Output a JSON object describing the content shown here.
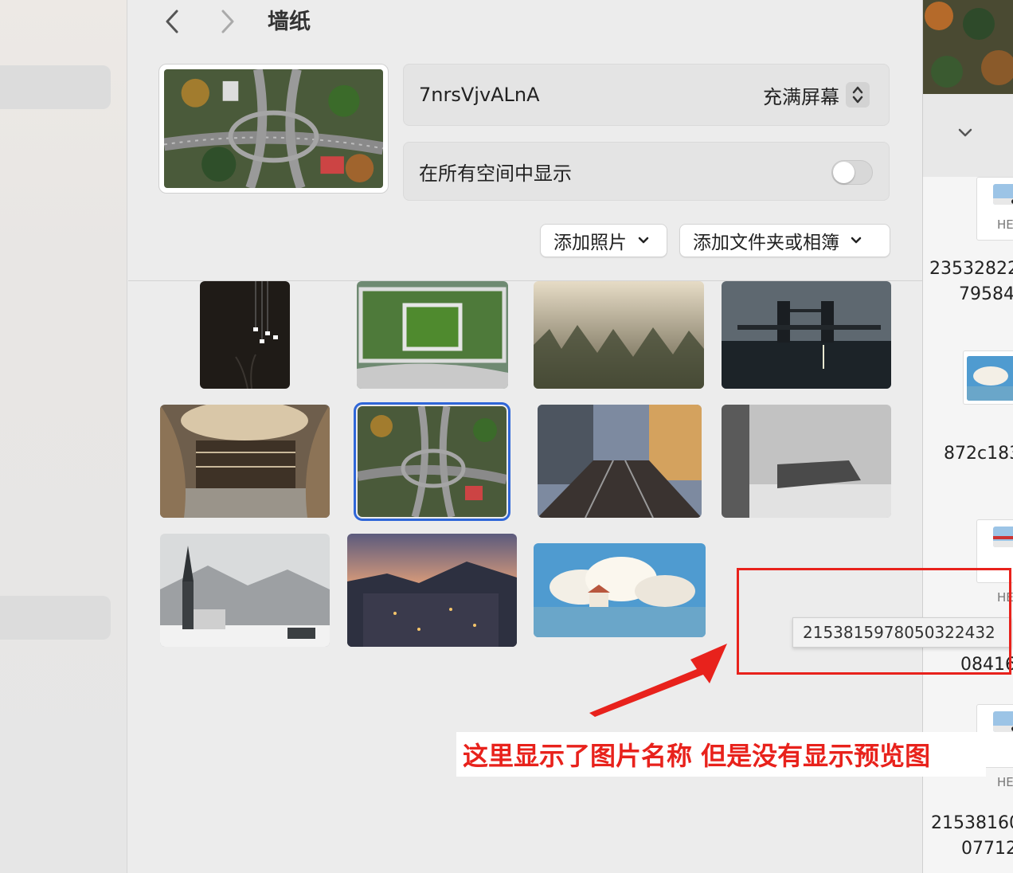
{
  "header": {
    "title": "墙纸"
  },
  "wallpaper": {
    "name": "7nrsVjvALnA",
    "fit_mode": "充满屏幕",
    "show_all_spaces_label": "在所有空间中显示",
    "show_all_spaces_on": false
  },
  "buttons": {
    "add_photo": "添加照片",
    "add_folder": "添加文件夹或相簿"
  },
  "gallery": [
    {
      "name": "pendant-lights"
    },
    {
      "name": "green-rooftop"
    },
    {
      "name": "foggy-forest"
    },
    {
      "name": "tower-bridge"
    },
    {
      "name": "atrium"
    },
    {
      "name": "highway-interchange",
      "selected": true
    },
    {
      "name": "railway-tracks"
    },
    {
      "name": "snow-train"
    },
    {
      "name": "alpine-church"
    },
    {
      "name": "city-dusk"
    },
    {
      "name": "cloud-house"
    }
  ],
  "tooltip": "215381597805032243​2",
  "right_panel": {
    "file_ext": "HE",
    "labels": [
      "23532822",
      "79584",
      "872c183",
      "08416",
      "21538160",
      "07712"
    ]
  },
  "annotation": {
    "text": "这里显示了图片名称 但是没有显示预览图",
    "color": "#e8221c"
  },
  "colors": {
    "accent": "#2f66d8",
    "annotation_red": "#e8221c"
  }
}
